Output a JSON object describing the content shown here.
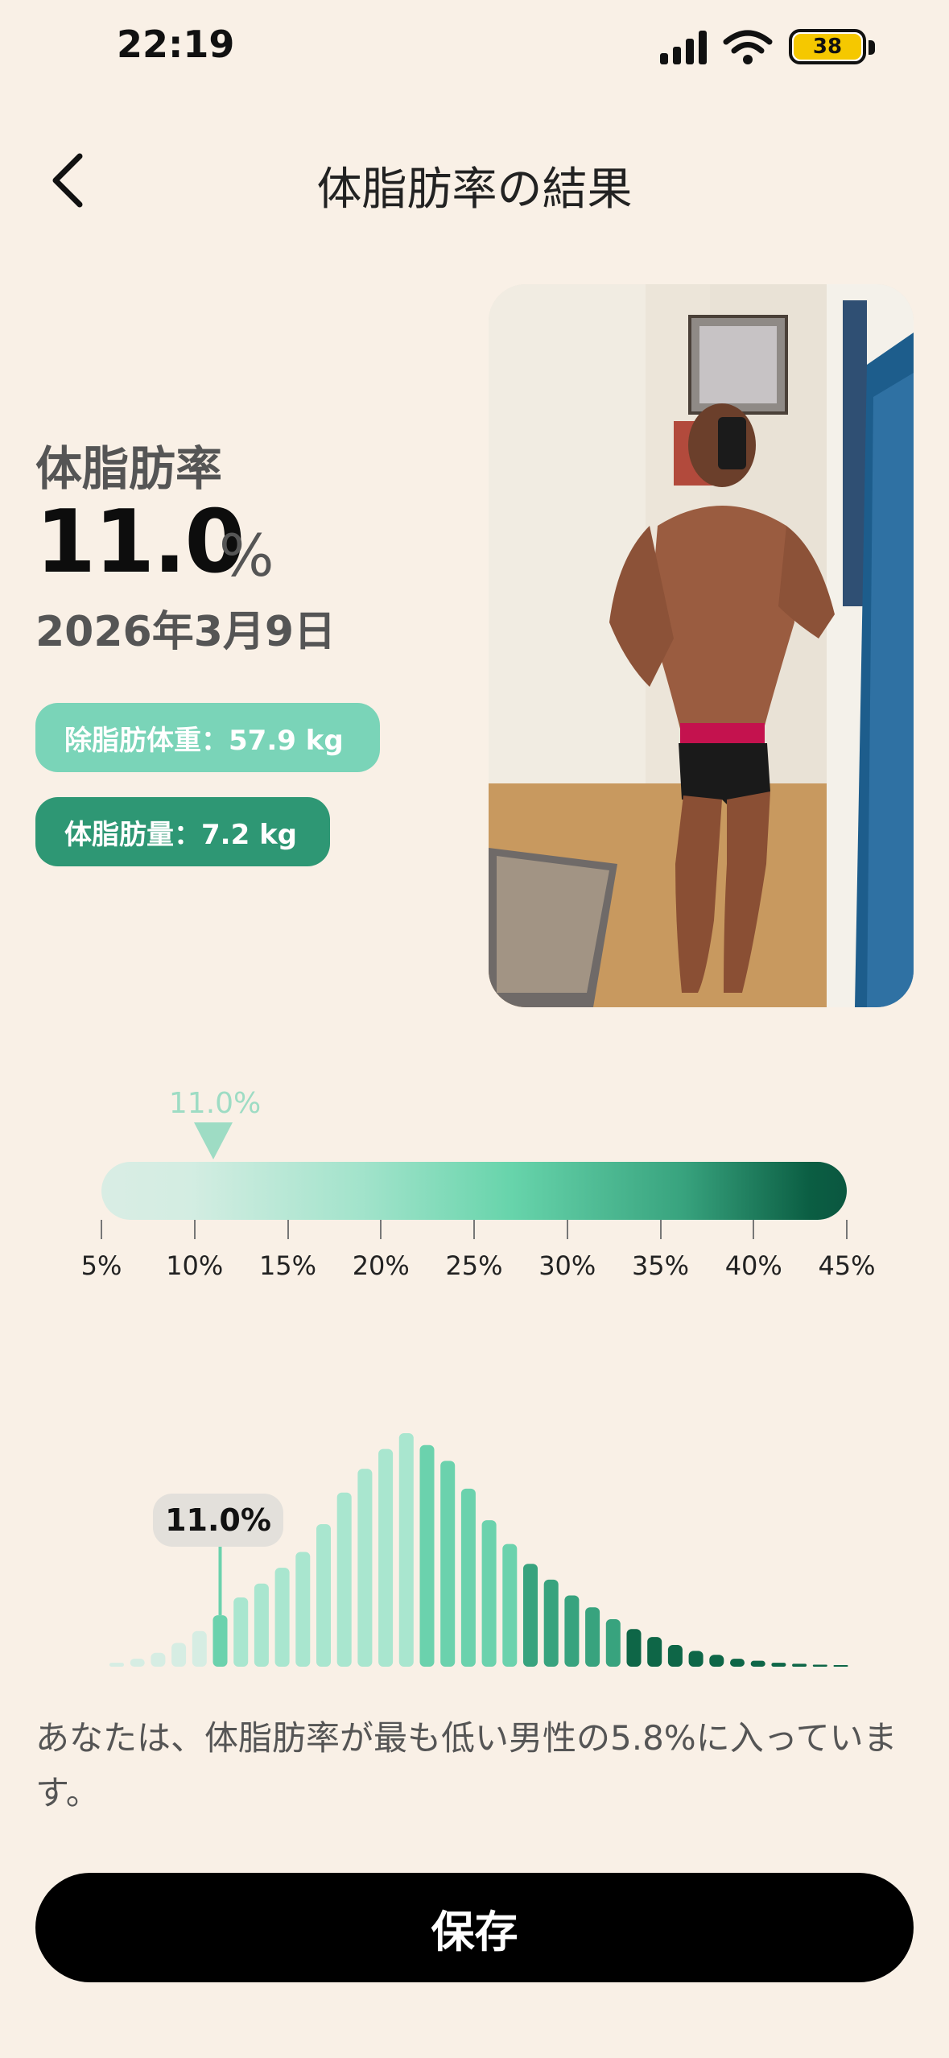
{
  "status_bar": {
    "time": "22:19",
    "battery_level": "38",
    "battery_color": "#f5c800"
  },
  "header": {
    "title": "体脂肪率の結果",
    "back_icon": "chevron-left-icon"
  },
  "metric": {
    "label": "体脂肪率",
    "value": "11.0",
    "unit": "%",
    "date": "2026年3月9日"
  },
  "pills": {
    "lean_mass": "除脂肪体重：57.9 kg",
    "fat_mass": "体脂肪量：7.2 kg",
    "lean_color": "#7ad4b8",
    "fat_color": "#2e9774"
  },
  "scale": {
    "marker_label": "11.0%",
    "marker_value": 11.0,
    "min": 5,
    "max": 45,
    "ticks": [
      "5%",
      "10%",
      "15%",
      "20%",
      "25%",
      "30%",
      "35%",
      "40%",
      "45%"
    ]
  },
  "histogram": {
    "callout": "11.0%",
    "highlight_index": 5,
    "values": [
      2,
      4,
      7,
      12,
      18,
      26,
      35,
      42,
      50,
      58,
      72,
      88,
      100,
      110,
      118,
      112,
      104,
      90,
      74,
      62,
      52,
      44,
      36,
      30,
      24,
      19,
      15,
      11,
      8,
      6,
      4,
      3,
      2,
      1.5,
      1,
      0.8
    ]
  },
  "percentile_text": "あなたは、体脂肪率が最も低い男性の5.8%に入っています。",
  "save_label": "保存"
}
